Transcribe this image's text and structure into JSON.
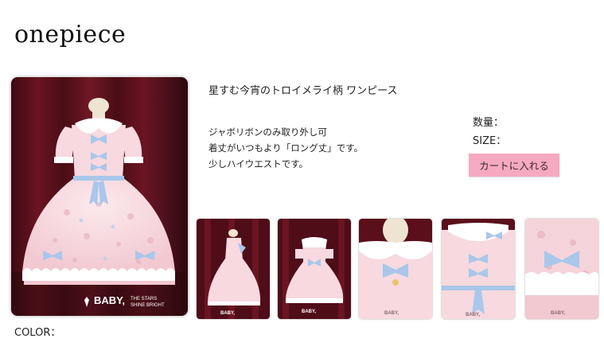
{
  "page": {
    "title": "onepiece"
  },
  "product": {
    "name": "星すむ今宵のトロイメライ柄 ワンピース",
    "description": [
      "ジャボリボンのみ取り外し可",
      "着丈がいつもより「ロング丈」です。",
      "少しハイウエストです。"
    ]
  },
  "purchase": {
    "quantity_label": "数量：",
    "size_label": "SIZE：",
    "cart_button_label": "カートに入れる"
  },
  "color_label": "COLOR：",
  "brand": {
    "logo_text": "BABY,",
    "tagline_top": "THE STARS",
    "tagline_bottom": "SHINE BRIGHT"
  },
  "thumbnails": [
    {
      "name": "thumbnail-side-view"
    },
    {
      "name": "thumbnail-back-view"
    },
    {
      "name": "thumbnail-collar-closeup"
    },
    {
      "name": "thumbnail-bodice-closeup"
    },
    {
      "name": "thumbnail-hem-closeup"
    }
  ],
  "colors": {
    "cart_button": "#f6a9c0",
    "backdrop": "#5a0f1a",
    "dress_pink": "#f7d9df",
    "ribbon_blue": "#a9c7ea"
  }
}
